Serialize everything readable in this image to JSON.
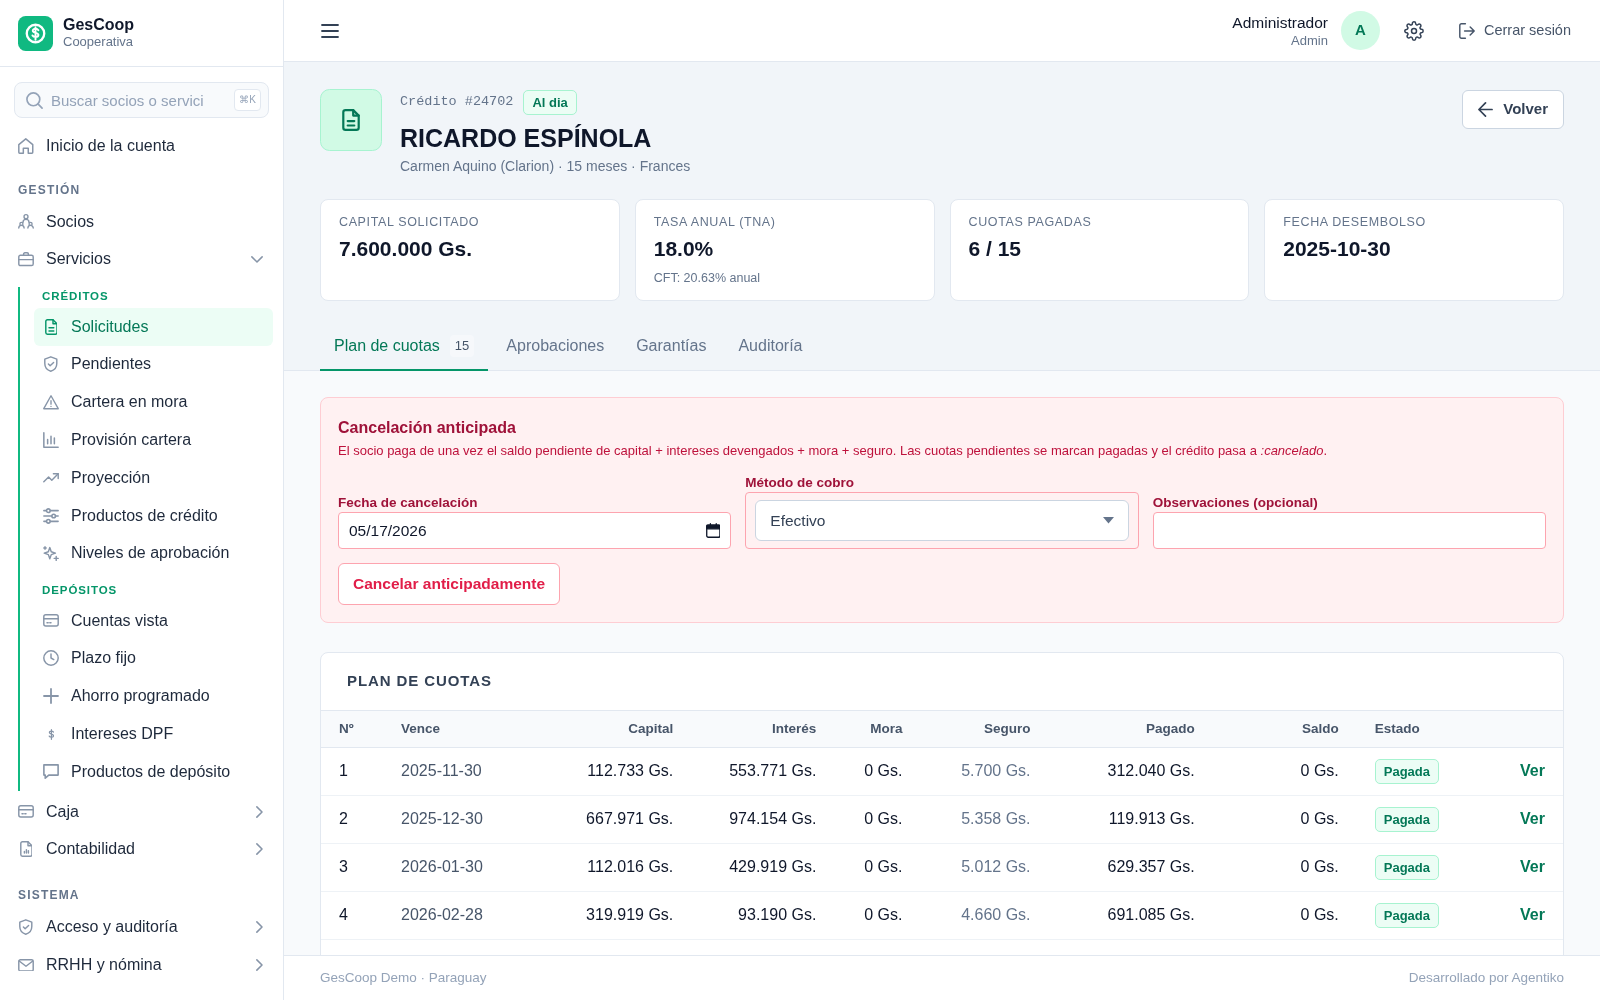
{
  "sidebar": {
    "brand": {
      "name": "GesCoop",
      "tagline": "Cooperativa"
    },
    "search": {
      "placeholder": "Buscar socios o servici",
      "shortcut": "⌘K"
    },
    "sections": [
      {
        "items": [
          {
            "kind": "link",
            "label": "Inicio de la cuenta",
            "selected": false
          }
        ]
      },
      {
        "title": "GESTIÓN",
        "items": [
          {
            "kind": "link",
            "label": "Socios",
            "selected": false
          },
          {
            "kind": "menu",
            "label": "Servicios",
            "selected": false,
            "expanded": true,
            "groups": [
              {
                "title": "CRÉDITOS",
                "children": [
                  {
                    "label": "Solicitudes",
                    "selected": true
                  },
                  {
                    "label": "Pendientes",
                    "selected": false
                  },
                  {
                    "label": "Cartera en mora",
                    "selected": false
                  },
                  {
                    "label": "Provisión cartera",
                    "selected": false
                  },
                  {
                    "label": "Proyección",
                    "selected": false
                  },
                  {
                    "label": "Productos de crédito",
                    "selected": false
                  },
                  {
                    "label": "Niveles de aprobación",
                    "selected": false
                  }
                ]
              },
              {
                "title": "DEPÓSITOS",
                "children": [
                  {
                    "label": "Cuentas vista",
                    "selected": false
                  },
                  {
                    "label": "Plazo fijo",
                    "selected": false
                  },
                  {
                    "label": "Ahorro programado",
                    "selected": false
                  },
                  {
                    "label": "Intereses DPF",
                    "selected": false
                  },
                  {
                    "label": "Productos de depósito",
                    "selected": false
                  }
                ]
              }
            ]
          },
          {
            "kind": "menu",
            "label": "Caja",
            "selected": false,
            "expanded": false
          },
          {
            "kind": "menu",
            "label": "Contabilidad",
            "selected": false,
            "expanded": false
          }
        ]
      },
      {
        "title": "SISTEMA",
        "items": [
          {
            "kind": "menu",
            "label": "Acceso y auditoría",
            "selected": false,
            "expanded": false
          },
          {
            "kind": "menu",
            "label": "RRHH y nómina",
            "selected": false,
            "expanded": false
          }
        ]
      }
    ]
  },
  "header": {
    "user": {
      "name": "Administrador",
      "role": "Admin",
      "initial": "A"
    },
    "logout": "Cerrar sesión"
  },
  "page_header": {
    "code": "Crédito #24702",
    "status": "Al dia",
    "title": "RICARDO ESPÍNOLA",
    "subtitle": "Carmen Aquino (Clarion) · 15 meses · Frances",
    "back_button": "Volver"
  },
  "stats": [
    {
      "label": "CAPITAL SOLICITADO",
      "value": "7.600.000 Gs."
    },
    {
      "label": "TASA ANUAL (TNA)",
      "value": "18.0%",
      "note": "CFT: 20.63% anual"
    },
    {
      "label": "CUOTAS PAGADAS",
      "value": "6 / 15"
    },
    {
      "label": "FECHA DESEMBOLSO",
      "value": "2025-10-30"
    }
  ],
  "tabs": [
    {
      "label": "Plan de cuotas",
      "count": "15",
      "selected": true
    },
    {
      "label": "Aprobaciones",
      "selected": false
    },
    {
      "label": "Garantías",
      "selected": false
    },
    {
      "label": "Auditoría",
      "selected": false
    }
  ],
  "early_cancellation": {
    "title": "Cancelación anticipada",
    "description": "El socio paga de una vez el saldo pendiente de capital + intereses devengados + mora + seguro. Las cuotas pendientes se marcan pagadas y el crédito pasa a *:cancelado*.",
    "fields": [
      {
        "kind": "date",
        "label": "Fecha de cancelación",
        "value": "05/17/2026"
      },
      {
        "kind": "select",
        "label": "Método de cobro",
        "value": "Efectivo"
      },
      {
        "kind": "text",
        "label": "Observaciones (opcional)"
      }
    ],
    "button": "Cancelar anticipadamente"
  },
  "schedule": {
    "title": "PLAN DE CUOTAS",
    "columns": [
      "Nº",
      "Vence",
      "Capital",
      "Interés",
      "Mora",
      "Seguro",
      "Pagado",
      "Saldo",
      "Estado"
    ],
    "rows": [
      {
        "cells": [
          "1",
          "2025-11-30",
          "112.733 Gs.",
          "553.771 Gs.",
          "0 Gs.",
          "5.700 Gs.",
          "312.040 Gs.",
          "0 Gs."
        ],
        "status": "Pagada",
        "action": "Ver"
      },
      {
        "cells": [
          "2",
          "2025-12-30",
          "667.971 Gs.",
          "974.154 Gs.",
          "0 Gs.",
          "5.358 Gs.",
          "119.913 Gs.",
          "0 Gs."
        ],
        "status": "Pagada",
        "action": "Ver"
      },
      {
        "cells": [
          "3",
          "2026-01-30",
          "112.016 Gs.",
          "429.919 Gs.",
          "0 Gs.",
          "5.012 Gs.",
          "629.357 Gs.",
          "0 Gs."
        ],
        "status": "Pagada",
        "action": "Ver"
      },
      {
        "cells": [
          "4",
          "2026-02-28",
          "319.919 Gs.",
          "93.190 Gs.",
          "0 Gs.",
          "4.660 Gs.",
          "691.085 Gs.",
          "0 Gs."
        ],
        "status": "Pagada",
        "action": "Ver"
      }
    ]
  },
  "footer": {
    "left": "GesCoop Demo · Paraguay",
    "right": "Desarrollado por Agentiko"
  }
}
